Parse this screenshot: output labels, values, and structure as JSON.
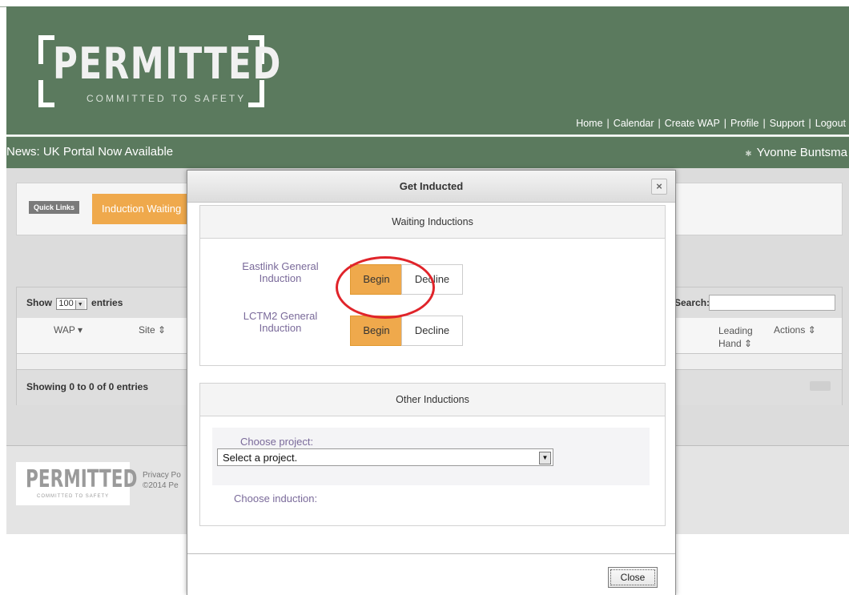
{
  "brand": {
    "logo_word": "PERMITTED",
    "logo_tagline": "COMMITTED TO SAFETY"
  },
  "topnav": {
    "home": "Home",
    "calendar": "Calendar",
    "create_wap": "Create WAP",
    "profile": "Profile",
    "support": "Support",
    "logout": "Logout",
    "sep": "|"
  },
  "newsbar": {
    "news": "News: UK Portal Now Available",
    "user": "Yvonne Buntsma"
  },
  "quicklinks": {
    "label": "Quick Links",
    "button": "Induction Waiting"
  },
  "table": {
    "show_prefix": "Show",
    "show_value": "100",
    "show_suffix": "entries",
    "search_label": "Search:",
    "columns": {
      "wap": "WAP",
      "site": "Site",
      "leading": "Leading",
      "hand": "Hand",
      "actions": "Actions"
    },
    "info": "Showing 0 to 0 of 0 entries"
  },
  "footer": {
    "logo_word": "PERMITTED",
    "logo_tagline": "COMMITTED TO SAFETY",
    "privacy": "Privacy Po",
    "copyright": "©2014 Pe"
  },
  "modal": {
    "title": "Get Inducted",
    "close_x": "×",
    "waiting_title": "Waiting Inductions",
    "inductions": [
      {
        "name": "Eastlink General Induction",
        "begin": "Begin",
        "decline": "Decline"
      },
      {
        "name": "LCTM2 General Induction",
        "begin": "Begin",
        "decline": "Decline"
      }
    ],
    "other_title": "Other Inductions",
    "choose_project": "Choose project:",
    "project_select": "Select a project.",
    "choose_induction": "Choose induction:",
    "close_button": "Close"
  },
  "colors": {
    "header_green": "#5b7a5e",
    "accent_orange": "#efa94c",
    "annotation_red": "#e0242a"
  }
}
